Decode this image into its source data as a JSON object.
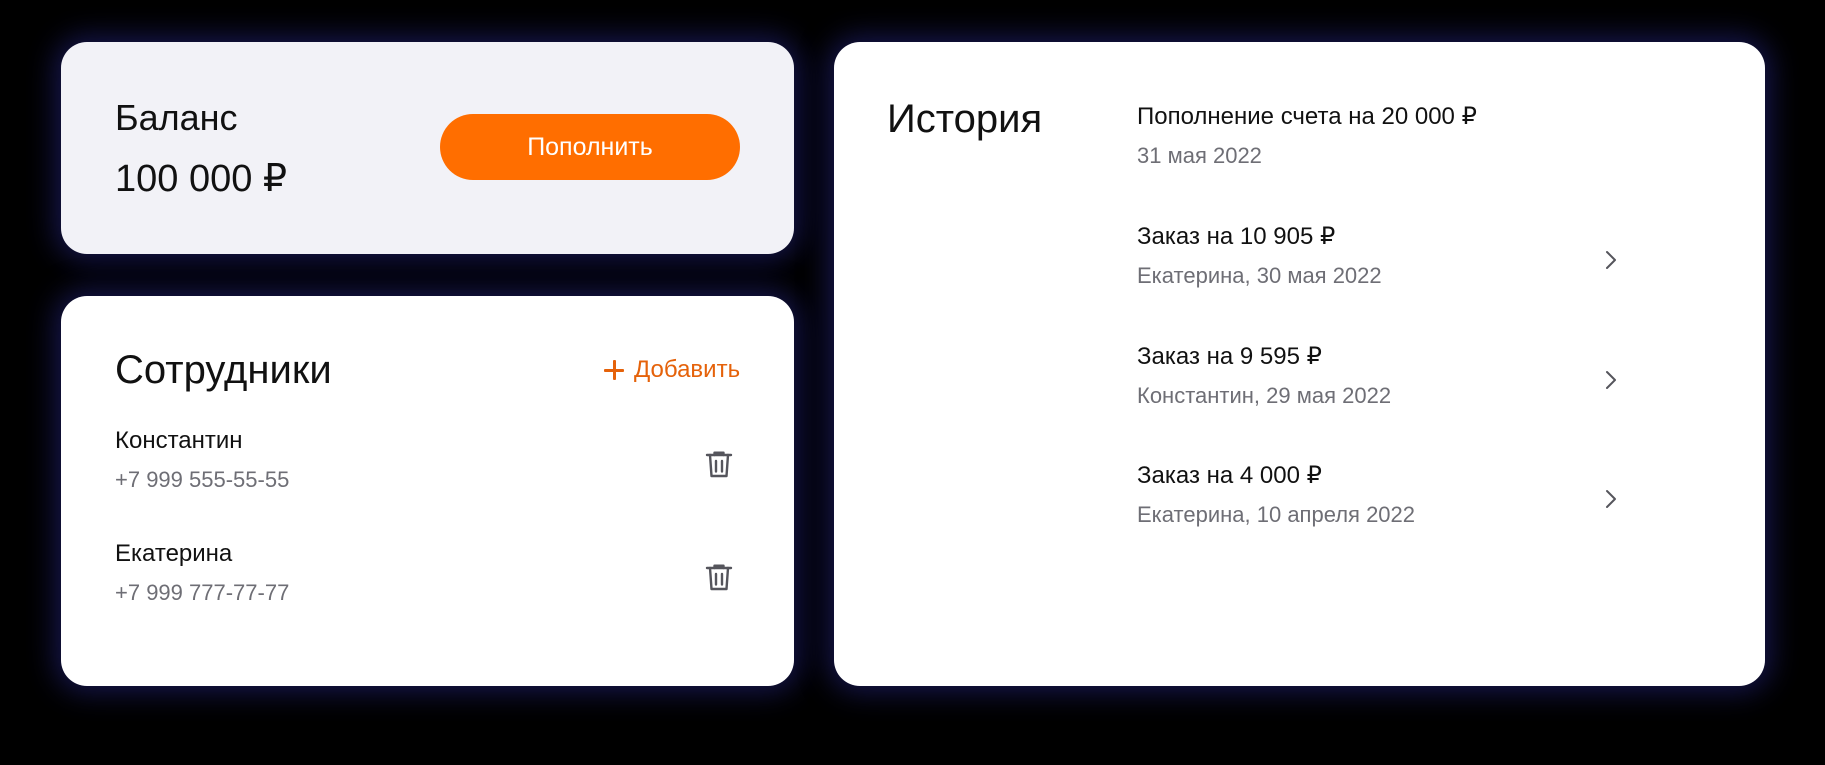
{
  "balance": {
    "title": "Баланс",
    "amount": "100 000 ₽",
    "topup_label": "Пополнить"
  },
  "employees": {
    "title": "Сотрудники",
    "add_label": "Добавить",
    "items": [
      {
        "name": "Константин",
        "phone": "+7 999 555-55-55"
      },
      {
        "name": "Екатерина",
        "phone": "+7 999 777-77-77"
      }
    ]
  },
  "history": {
    "title": "История",
    "items": [
      {
        "title": "Пополнение счета на 20 000 ₽",
        "subtitle": "31 мая 2022"
      },
      {
        "title": "Заказ на 10 905 ₽",
        "subtitle": "Екатерина, 30 мая 2022"
      },
      {
        "title": "Заказ на 9 595 ₽",
        "subtitle": "Константин, 29 мая 2022"
      },
      {
        "title": "Заказ на 4 000 ₽",
        "subtitle": "Екатерина, 10 апреля 2022"
      }
    ]
  },
  "colors": {
    "accent": "#ff6e00",
    "accent_text": "#e5620a",
    "muted_text": "#6e6e75",
    "balance_card_bg": "#f2f2f7"
  },
  "icons": {
    "add": "plus-icon",
    "delete": "trash-icon",
    "open": "chevron-right-icon"
  }
}
